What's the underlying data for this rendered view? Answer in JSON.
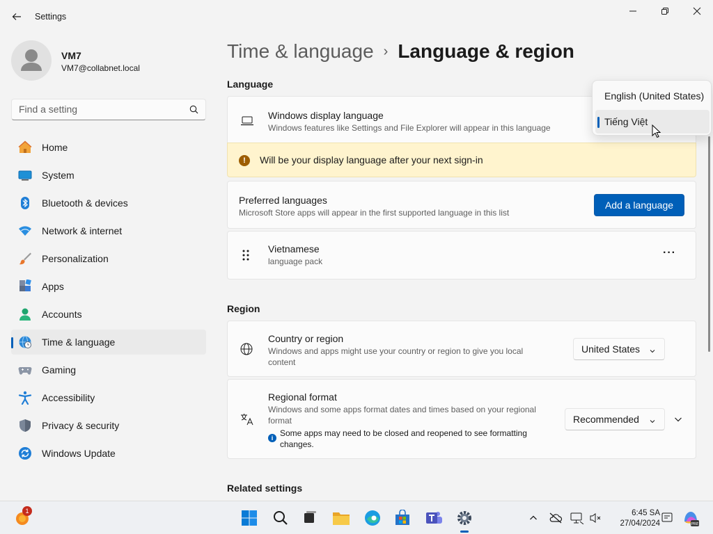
{
  "window": {
    "title": "Settings"
  },
  "profile": {
    "name": "VM7",
    "email": "VM7@collabnet.local"
  },
  "search": {
    "placeholder": "Find a setting"
  },
  "sidebar": {
    "items": [
      {
        "label": "Home",
        "icon": "home-icon"
      },
      {
        "label": "System",
        "icon": "system-icon"
      },
      {
        "label": "Bluetooth & devices",
        "icon": "bluetooth-icon"
      },
      {
        "label": "Network & internet",
        "icon": "network-icon"
      },
      {
        "label": "Personalization",
        "icon": "personalization-icon"
      },
      {
        "label": "Apps",
        "icon": "apps-icon"
      },
      {
        "label": "Accounts",
        "icon": "accounts-icon"
      },
      {
        "label": "Time & language",
        "icon": "time-language-icon",
        "active": true
      },
      {
        "label": "Gaming",
        "icon": "gaming-icon"
      },
      {
        "label": "Accessibility",
        "icon": "accessibility-icon"
      },
      {
        "label": "Privacy & security",
        "icon": "shield-icon"
      },
      {
        "label": "Windows Update",
        "icon": "update-icon"
      }
    ]
  },
  "breadcrumb": {
    "parent": "Time & language",
    "separator": "›",
    "current": "Language & region"
  },
  "language": {
    "section_title": "Language",
    "display": {
      "title": "Windows display language",
      "subtitle": "Windows features like Settings and File Explorer will appear in this language"
    },
    "warning": "Will be your display language after your next sign-in",
    "preferred": {
      "title": "Preferred languages",
      "subtitle": "Microsoft Store apps will appear in the first supported language in this list",
      "button": "Add a language"
    },
    "entry": {
      "title": "Vietnamese",
      "subtitle": "language pack",
      "more": "···"
    }
  },
  "flyout": {
    "options": [
      "English (United States)",
      "Tiếng Việt"
    ],
    "selected": "Tiếng Việt"
  },
  "region": {
    "section_title": "Region",
    "country": {
      "title": "Country or region",
      "subtitle": "Windows and apps might use your country or region to give you local content",
      "value": "United States"
    },
    "format": {
      "title": "Regional format",
      "subtitle": "Windows and some apps format dates and times based on your regional format",
      "value": "Recommended",
      "info": "Some apps may need to be closed and reopened to see formatting changes."
    }
  },
  "related": {
    "section_title": "Related settings"
  },
  "taskbar": {
    "notification_count": "1",
    "time": "6:45 SA",
    "date": "27/04/2024"
  },
  "colors": {
    "accent": "#005fb8",
    "warning_bg": "#fff4ce"
  }
}
